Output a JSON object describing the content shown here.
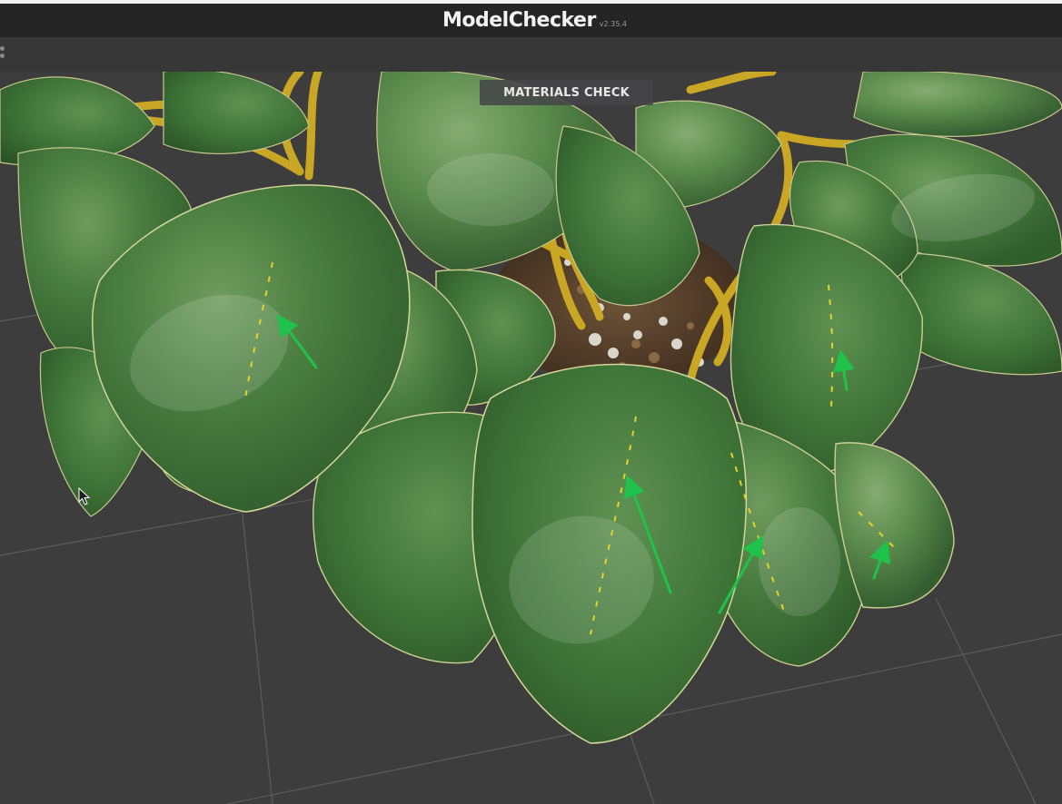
{
  "app": {
    "name": "ModelChecker",
    "version": "v2.35.4"
  },
  "viewport": {
    "mode_label": "MATERIALS CHECK"
  },
  "colors": {
    "title_bar": "#252526",
    "toolbar": "#373738",
    "viewport_bg": "#3d3d3e",
    "grid_line": "#5a5a5a",
    "leaf_green": "#3f7a3a",
    "stem_yellow": "#c9a623",
    "annotation_arrow": "#1fc24a"
  },
  "icons": {
    "menu": "menu-dots-icon",
    "cursor": "mouse-pointer-icon"
  }
}
